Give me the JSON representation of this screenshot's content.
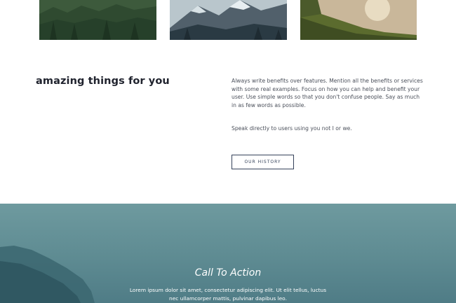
{
  "features": {
    "heading": "amazing things for you",
    "paragraph_1": "Always write benefits over features. Mention all the benefits or services with some real examples. Focus on how you can help and benefit your user. Use simple words so that you don't confuse people. Say as much in as few words as possible.",
    "paragraph_2": "Speak directly to users using you not I or we.",
    "button_label": "OUR HISTORY"
  },
  "cta": {
    "title": "Call To Action",
    "body": "Lorem ipsum dolor sit amet, consectetur adipiscing elit. Ut elit tellus, luctus nec ullamcorper mattis, pulvinar dapibus leo."
  },
  "colors": {
    "heading": "#20232e",
    "button_border": "#35425a",
    "cta_teal": "#5e8b92"
  }
}
